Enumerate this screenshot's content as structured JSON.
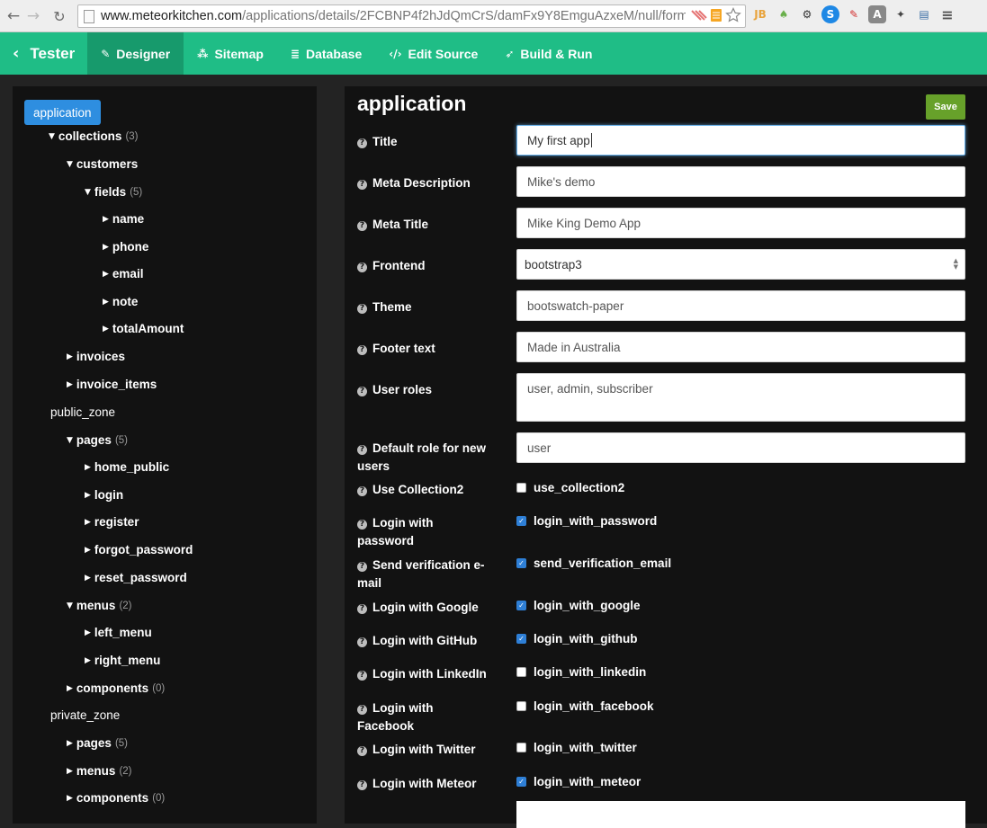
{
  "browser": {
    "url_host": "www.meteorkitchen.com",
    "url_path": "/applications/details/2FCBNP4f2hJdQmCrS/damFx9Y8EmguAzxeM/null/form..."
  },
  "navbar": {
    "brand": "Tester",
    "items": [
      {
        "label": "Designer",
        "icon": "edit-icon",
        "active": true
      },
      {
        "label": "Sitemap",
        "icon": "sitemap-icon",
        "active": false
      },
      {
        "label": "Database",
        "icon": "database-icon",
        "active": false
      },
      {
        "label": "Edit Source",
        "icon": "code-icon",
        "active": false
      },
      {
        "label": "Build & Run",
        "icon": "rocket-icon",
        "active": false
      }
    ]
  },
  "tree": {
    "root": "application",
    "items": [
      {
        "label": "collections",
        "count": "(3)",
        "caret": "down"
      },
      {
        "label": "customers",
        "count": "",
        "caret": "down"
      },
      {
        "label": "fields",
        "count": "(5)",
        "caret": "down"
      },
      {
        "label": "name",
        "count": "",
        "caret": "right"
      },
      {
        "label": "phone",
        "count": "",
        "caret": "right"
      },
      {
        "label": "email",
        "count": "",
        "caret": "right"
      },
      {
        "label": "note",
        "count": "",
        "caret": "right"
      },
      {
        "label": "totalAmount",
        "count": "",
        "caret": "right"
      },
      {
        "label": "invoices",
        "count": "",
        "caret": "right"
      },
      {
        "label": "invoice_items",
        "count": "",
        "caret": "right"
      },
      {
        "label": "public_zone",
        "count": "",
        "caret": "none"
      },
      {
        "label": "pages",
        "count": "(5)",
        "caret": "down"
      },
      {
        "label": "home_public",
        "count": "",
        "caret": "right"
      },
      {
        "label": "login",
        "count": "",
        "caret": "right"
      },
      {
        "label": "register",
        "count": "",
        "caret": "right"
      },
      {
        "label": "forgot_password",
        "count": "",
        "caret": "right"
      },
      {
        "label": "reset_password",
        "count": "",
        "caret": "right"
      },
      {
        "label": "menus",
        "count": "(2)",
        "caret": "down"
      },
      {
        "label": "left_menu",
        "count": "",
        "caret": "right"
      },
      {
        "label": "right_menu",
        "count": "",
        "caret": "right"
      },
      {
        "label": "components",
        "count": "(0)",
        "caret": "right"
      },
      {
        "label": "private_zone",
        "count": "",
        "caret": "none"
      },
      {
        "label": "pages",
        "count": "(5)",
        "caret": "right"
      },
      {
        "label": "menus",
        "count": "(2)",
        "caret": "right"
      },
      {
        "label": "components",
        "count": "(0)",
        "caret": "right"
      }
    ]
  },
  "form": {
    "title": "application",
    "save_label": "Save",
    "fields": [
      {
        "label": "Title",
        "value": "My first app"
      },
      {
        "label": "Meta Description",
        "value": "Mike's demo"
      },
      {
        "label": "Meta Title",
        "value": "Mike King Demo App"
      },
      {
        "label": "Frontend",
        "value": "bootstrap3"
      },
      {
        "label": "Theme",
        "value": "bootswatch-paper"
      },
      {
        "label": "Footer text",
        "value": "Made in Australia"
      },
      {
        "label": "User roles",
        "value": "user, admin, subscriber"
      },
      {
        "label": "Default role for new users",
        "value": "user"
      }
    ],
    "checkboxes": [
      {
        "label": "Use Collection2",
        "name": "use_collection2",
        "checked": false
      },
      {
        "label": "Login with password",
        "name": "login_with_password",
        "checked": true
      },
      {
        "label": "Send verification e-mail",
        "name": "send_verification_email",
        "checked": true
      },
      {
        "label": "Login with Google",
        "name": "login_with_google",
        "checked": true
      },
      {
        "label": "Login with GitHub",
        "name": "login_with_github",
        "checked": true
      },
      {
        "label": "Login with LinkedIn",
        "name": "login_with_linkedin",
        "checked": false
      },
      {
        "label": "Login with Facebook",
        "name": "login_with_facebook",
        "checked": false
      },
      {
        "label": "Login with Twitter",
        "name": "login_with_twitter",
        "checked": false
      },
      {
        "label": "Login with Meteor",
        "name": "login_with_meteor",
        "checked": true
      }
    ]
  },
  "colors": {
    "navbar": "#1fbd86",
    "navbar_active": "#179a6c",
    "tree_root": "#2e8ee0",
    "save_button": "#67a12a",
    "checkbox_on": "#2e7fd6"
  }
}
